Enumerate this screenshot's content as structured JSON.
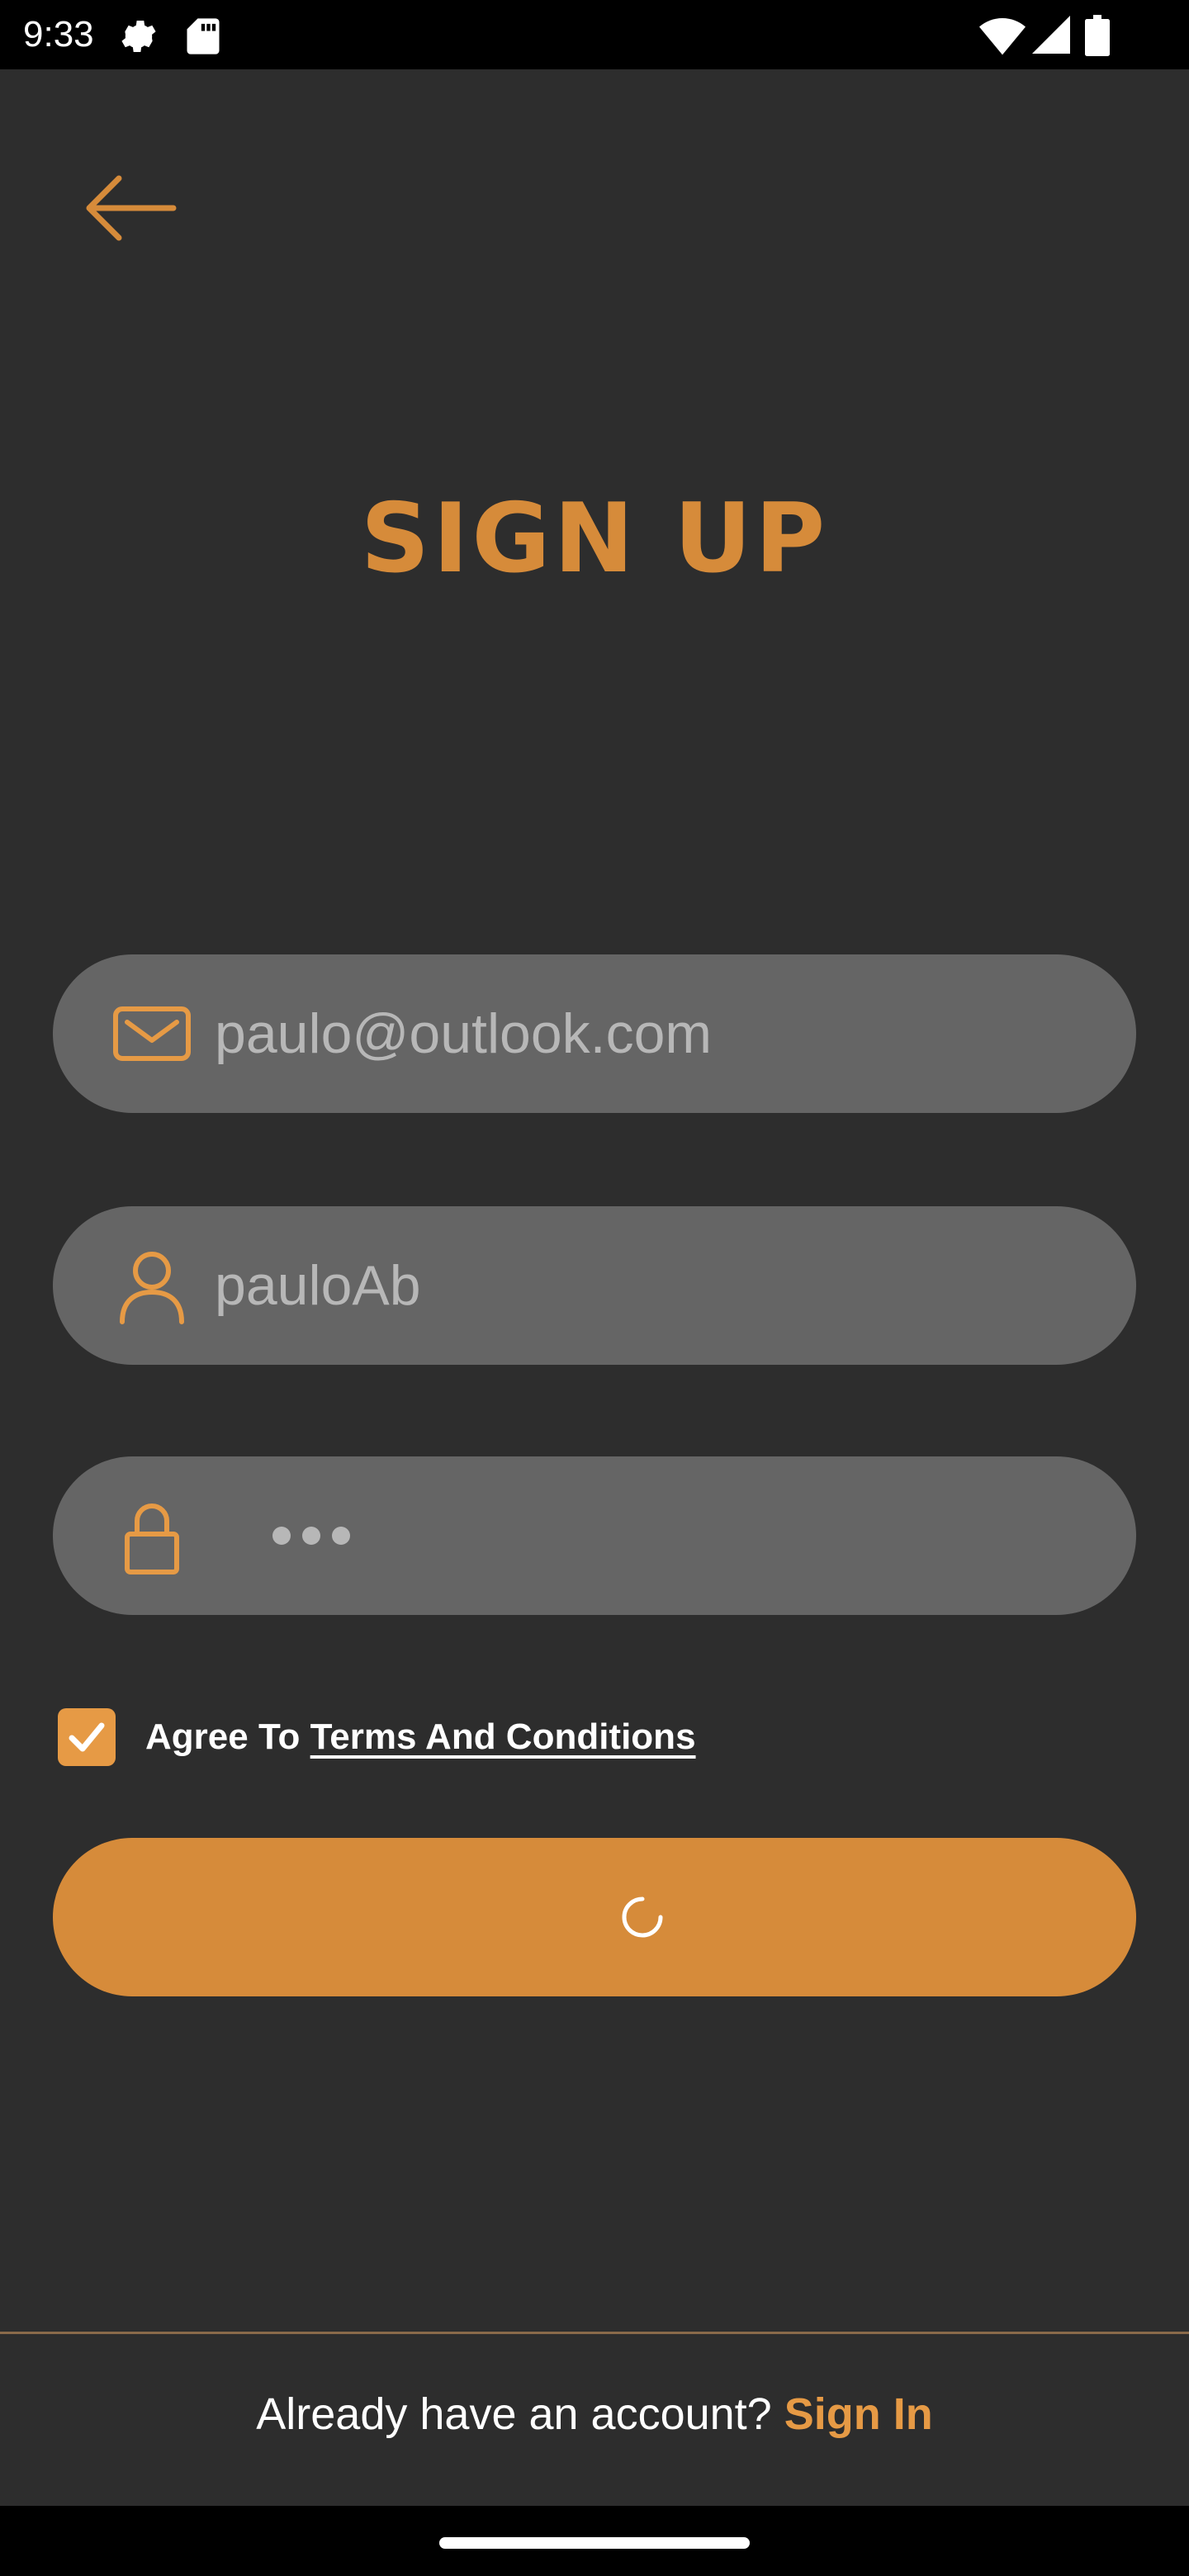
{
  "status_bar": {
    "time": "9:33",
    "icons": [
      "settings-icon",
      "sd-card-icon",
      "wifi-icon",
      "signal-icon",
      "battery-icon"
    ]
  },
  "header": {
    "back_icon": "arrow-left-icon",
    "title": "SIGN UP"
  },
  "form": {
    "email": {
      "icon": "mail-icon",
      "value": "paulo@outlook.com"
    },
    "username": {
      "icon": "user-icon",
      "value": "pauloAb"
    },
    "password": {
      "icon": "lock-icon",
      "masked_length": 3
    },
    "terms": {
      "checked": true,
      "prefix": "Agree To ",
      "link_text": "Terms And Conditions"
    },
    "submit": {
      "state": "loading",
      "icon": "spinner-icon"
    }
  },
  "footer": {
    "prompt": "Already have an account? ",
    "link": "Sign In"
  },
  "colors": {
    "accent": "#d68b3a",
    "background": "#2d2d2d",
    "field": "#656565"
  }
}
